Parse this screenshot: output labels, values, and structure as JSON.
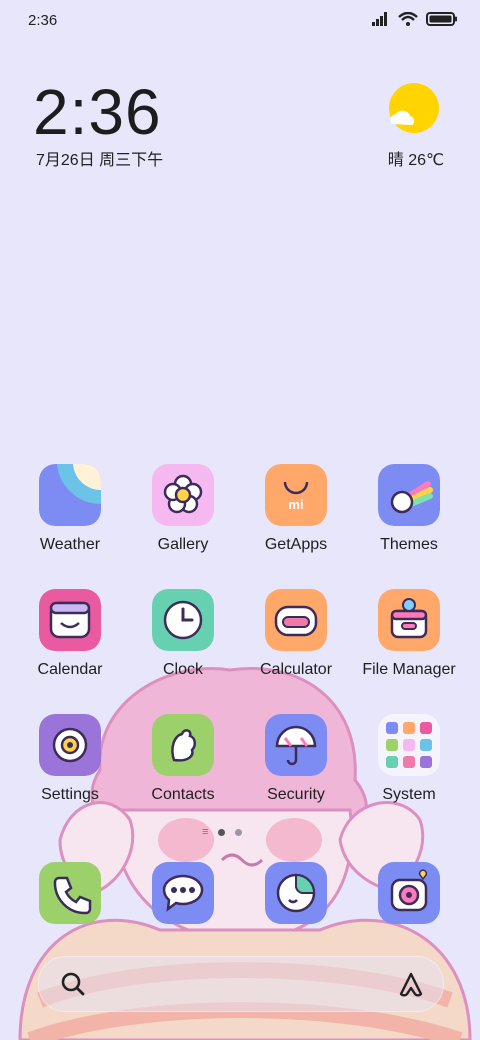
{
  "status": {
    "time": "2:36"
  },
  "lockscreen": {
    "clock": "2:36",
    "date": "7月26日 周三下午",
    "weather": "晴 26℃"
  },
  "apps": [
    {
      "label": "Weather",
      "icon": "weather-icon"
    },
    {
      "label": "Gallery",
      "icon": "gallery-icon"
    },
    {
      "label": "GetApps",
      "icon": "getapps-icon"
    },
    {
      "label": "Themes",
      "icon": "themes-icon"
    },
    {
      "label": "Calendar",
      "icon": "calendar-icon"
    },
    {
      "label": "Clock",
      "icon": "clock-icon"
    },
    {
      "label": "Calculator",
      "icon": "calculator-icon"
    },
    {
      "label": "File Manager",
      "icon": "file-manager-icon"
    },
    {
      "label": "Settings",
      "icon": "settings-icon"
    },
    {
      "label": "Contacts",
      "icon": "contacts-icon"
    },
    {
      "label": "Security",
      "icon": "security-icon"
    },
    {
      "label": "System",
      "icon": "system-folder-icon"
    }
  ],
  "dock": [
    {
      "icon": "phone-icon"
    },
    {
      "icon": "messages-icon"
    },
    {
      "icon": "browser-icon"
    },
    {
      "icon": "camera-icon"
    }
  ],
  "colors": {
    "background": "#e8e6fb",
    "sun": "#ffd400"
  }
}
